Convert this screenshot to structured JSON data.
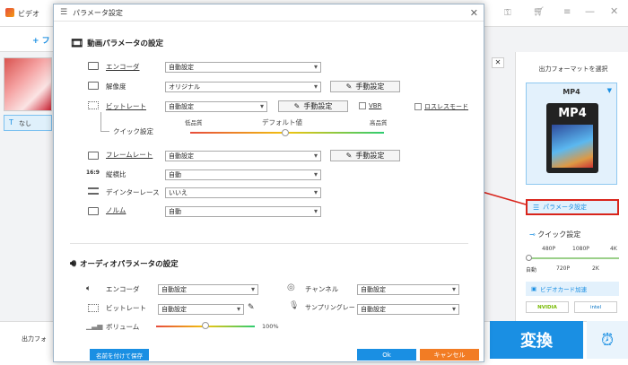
{
  "background_app": {
    "title_fragment": "ビデオ",
    "toolbar_fragment": "+ フ",
    "subtitle_fragment": "なし",
    "output_fragment": "出力フォ",
    "output_format_title": "出力フォーマットを選択",
    "format_name": "MP4",
    "format_icon_text": "MP4",
    "param_settings_label": "パラメータ設定",
    "quick_settings_label": "クイック設定",
    "quick_top": [
      "480P",
      "1080P",
      "4K"
    ],
    "quick_bottom": [
      "自動",
      "720P",
      "2K"
    ],
    "gpu_label": "ビデオカード加速",
    "brand_nvidia": "NVIDIA",
    "brand_intel": "intel",
    "convert_label": "変換"
  },
  "dialog": {
    "title": "パラメータ設定",
    "video_section_title": "動画パラメータの設定",
    "audio_section_title": "オーディオパラメータの設定",
    "manual_label": "手動設定",
    "video": {
      "encoder_label": "エンコーダ",
      "encoder_value": "自動設定",
      "resolution_label": "解像度",
      "resolution_value": "オリジナル",
      "bitrate_label": "ビットレート",
      "bitrate_value": "自動設定",
      "vbr_label": "VBR",
      "lossless_label": "ロスレスモード",
      "quick_label": "クイック設定",
      "quality_low": "低品質",
      "quality_default": "デフォルト値",
      "quality_high": "高品質",
      "framerate_label": "フレームレート",
      "framerate_value": "自動設定",
      "aspect_label": "縦横比",
      "aspect_value": "自動",
      "deinterlace_label": "デインターレース",
      "deinterlace_value": "いいえ",
      "norm_label": "ノルム",
      "norm_value": "自動"
    },
    "audio": {
      "encoder_label": "エンコーダ",
      "encoder_value": "自動設定",
      "bitrate_label": "ビットレート",
      "bitrate_value": "自動設定",
      "volume_label": "ボリューム",
      "volume_value": "100%",
      "channel_label": "チャンネル",
      "channel_value": "自動設定",
      "samplerate_label": "サンプリングレート",
      "samplerate_value": "自動設定"
    },
    "save_label": "名前を付けて保存",
    "ok_label": "Ok",
    "cancel_label": "キャンセル"
  },
  "colors": {
    "accent": "#1a8fe3",
    "cancel": "#f27c24",
    "highlight": "#d9241b"
  }
}
